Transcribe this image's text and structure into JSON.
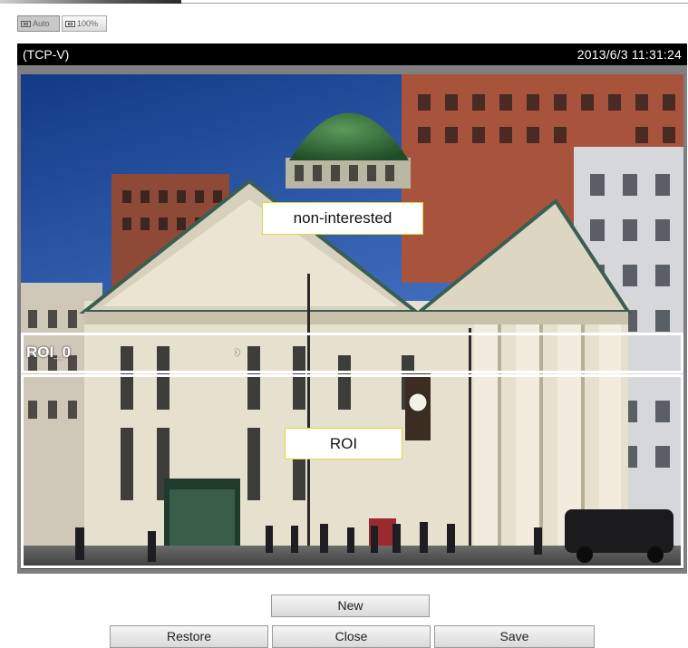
{
  "toolbar": {
    "auto_label": "Auto",
    "zoom_label": "100%",
    "auto_icon": "fit-window-icon",
    "zoom_icon": "actual-size-icon"
  },
  "video": {
    "stream_label": "(TCP-V)",
    "timestamp": "2013/6/3 11:31:24"
  },
  "overlays": {
    "non_interested_label": "non-interested",
    "roi_label": "ROI",
    "roi_window_name": "ROI_0",
    "roi_window_arrow": "›"
  },
  "buttons": {
    "new_label": "New",
    "restore_label": "Restore",
    "close_label": "Close",
    "save_label": "Save"
  },
  "colors": {
    "label_border": "#e3d63b",
    "roi_border": "#ffffff",
    "title_bar": "#000000",
    "frame": "#7f7f7f"
  }
}
